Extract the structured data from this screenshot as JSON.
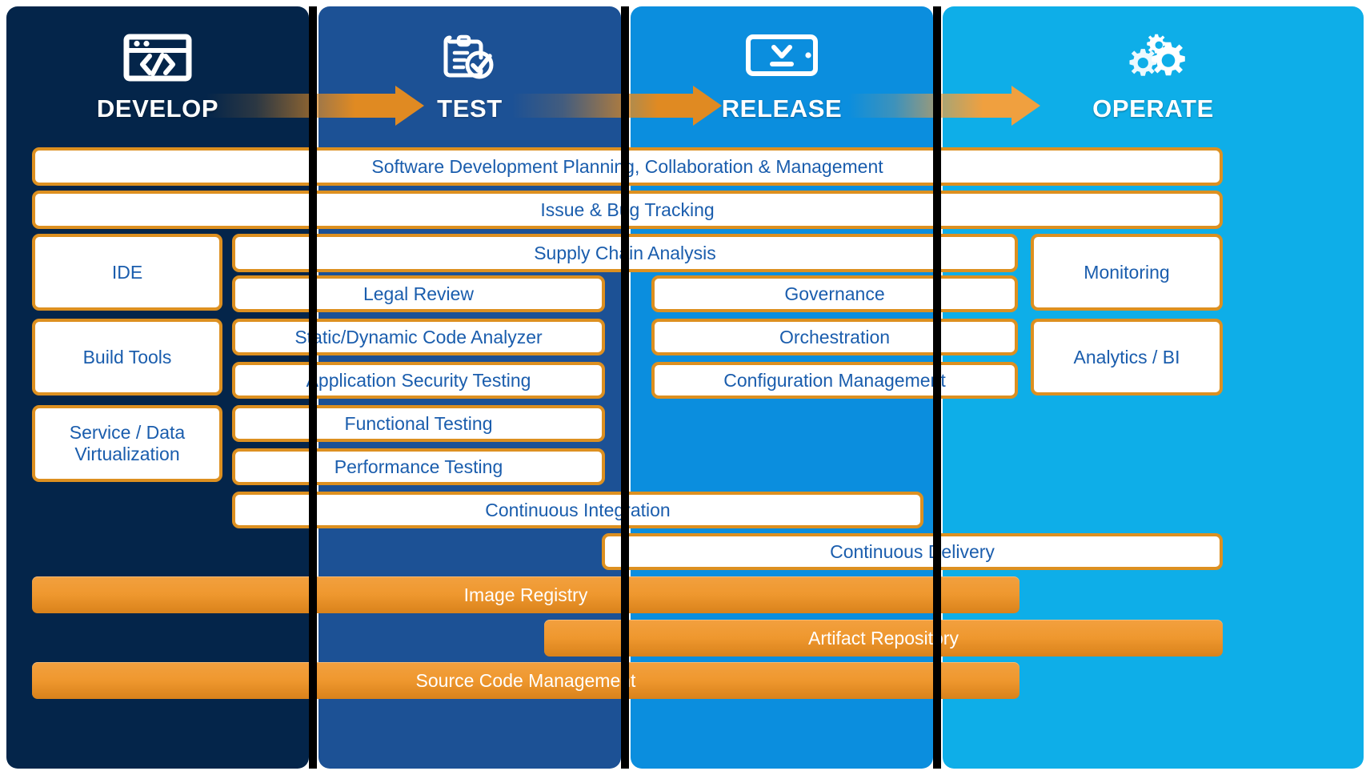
{
  "stages": [
    {
      "key": "develop",
      "label": "DEVELOP",
      "icon": "code-window-icon",
      "color": "#04254a"
    },
    {
      "key": "test",
      "label": "TEST",
      "icon": "clipboard-check-icon",
      "color": "#1c5195"
    },
    {
      "key": "release",
      "label": "RELEASE",
      "icon": "device-download-icon",
      "color": "#0b8ede"
    },
    {
      "key": "operate",
      "label": "OPERATE",
      "icon": "gears-icon",
      "color": "#0eaee8"
    }
  ],
  "arrows": [
    {
      "name": "arrow-develop-to-test"
    },
    {
      "name": "arrow-test-to-release"
    },
    {
      "name": "arrow-release-to-operate"
    }
  ],
  "full_width_bars": [
    {
      "label": "Software Development Planning, Collaboration & Management",
      "name": "bar-software-development-planning"
    },
    {
      "label": "Issue & Bug Tracking",
      "name": "bar-issue-bug-tracking"
    }
  ],
  "develop_boxes": [
    {
      "label": "IDE",
      "name": "box-ide"
    },
    {
      "label": "Build Tools",
      "name": "box-build-tools"
    },
    {
      "label": "Service / Data Virtualization",
      "name": "box-service-data-virtualization"
    }
  ],
  "center_boxes": [
    {
      "label": "Supply Chain Analysis",
      "name": "box-supply-chain-analysis"
    },
    {
      "label": "Legal Review",
      "name": "box-legal-review"
    },
    {
      "label": "Static/Dynamic Code Analyzer",
      "name": "box-static-dynamic-code-analyzer"
    },
    {
      "label": "Application Security Testing",
      "name": "box-application-security-testing"
    },
    {
      "label": "Functional Testing",
      "name": "box-functional-testing"
    },
    {
      "label": "Performance Testing",
      "name": "box-performance-testing"
    },
    {
      "label": "Continuous Integration",
      "name": "box-continuous-integration"
    }
  ],
  "release_boxes": [
    {
      "label": "Governance",
      "name": "box-governance"
    },
    {
      "label": "Orchestration",
      "name": "box-orchestration"
    },
    {
      "label": "Configuration Management",
      "name": "box-configuration-management"
    },
    {
      "label": "Continuous Delivery",
      "name": "box-continuous-delivery"
    }
  ],
  "operate_boxes": [
    {
      "label": "Monitoring",
      "name": "box-monitoring"
    },
    {
      "label": "Analytics / BI",
      "name": "box-analytics-bi"
    }
  ],
  "orange_bars": [
    {
      "label": "Image Registry",
      "name": "bar-image-registry"
    },
    {
      "label": "Artifact Repository",
      "name": "bar-artifact-repository"
    },
    {
      "label": "Source Code Management",
      "name": "bar-source-code-management"
    }
  ],
  "colors": {
    "develop": "#04254a",
    "test": "#1c5195",
    "release": "#0b8ede",
    "operate": "#0eaee8",
    "accent_orange": "#dd9020",
    "arrow_orange": "#e08a22",
    "box_text_blue": "#1a5dad",
    "bar_text": "#ffffff"
  }
}
